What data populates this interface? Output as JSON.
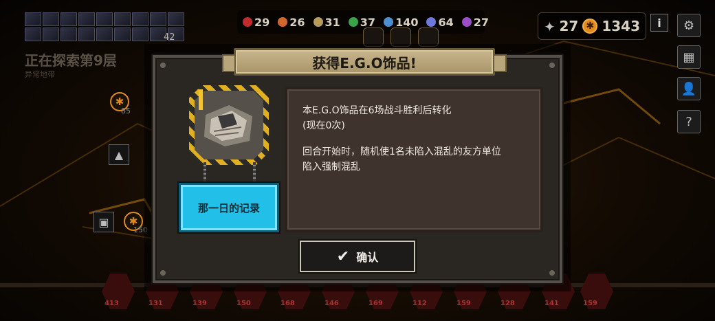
{
  "hud": {
    "party_count": "42",
    "explore_title": "正在探索第9层",
    "explore_sub": "异常地带",
    "resources": [
      {
        "icon": "blood-drop-icon",
        "color": "#c22b2b",
        "value": "29"
      },
      {
        "icon": "flesh-icon",
        "color": "#d2672e",
        "value": "26"
      },
      {
        "icon": "ore-icon",
        "color": "#b89a5a",
        "value": "31"
      },
      {
        "icon": "leaf-icon",
        "color": "#3aa34a",
        "value": "37"
      },
      {
        "icon": "cog-icon",
        "color": "#4c8fd0",
        "value": "140"
      },
      {
        "icon": "gem-icon",
        "color": "#6d78d8",
        "value": "64"
      },
      {
        "icon": "crystal-icon",
        "color": "#9b4fc6",
        "value": "27"
      }
    ],
    "level_value": "27",
    "coin_value": "1343",
    "info_label": "i",
    "left_nodes": {
      "coin_top": "85",
      "coin_bottom": "150"
    }
  },
  "dialog": {
    "title": "获得E.G.O饰品!",
    "item_name": "那一日的记录",
    "desc_line1": "本E.G.O饰品在6场战斗胜利后转化",
    "desc_line2": "(现在0次)",
    "desc_line3": "回合开始时，随机使1名未陷入混乱的友方单位",
    "desc_line4": "陷入强制混乱",
    "confirm_label": "确认"
  },
  "units": {
    "hp_values": [
      "413",
      "131",
      "139",
      "150",
      "168",
      "146",
      "169",
      "112",
      "159",
      "128",
      "141",
      "159"
    ]
  }
}
